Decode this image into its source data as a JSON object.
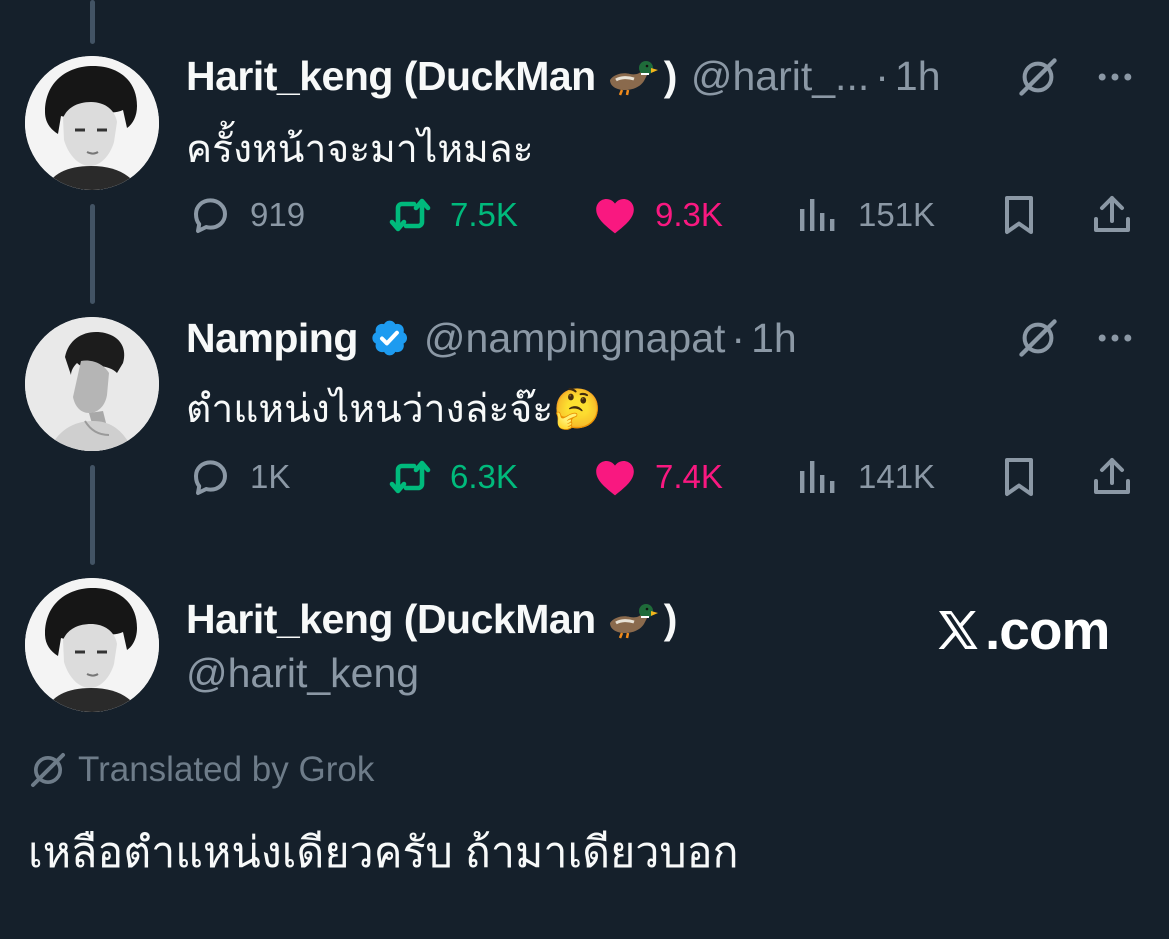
{
  "tweets": [
    {
      "display_name": "Harit_keng (DuckMan",
      "name_suffix": ")",
      "handle": "@harit_...",
      "separator": "·",
      "time": "1h",
      "text": "ครั้งหน้าจะมาไหมละ",
      "replies": "919",
      "retweets": "7.5K",
      "likes": "9.3K",
      "views": "151K"
    },
    {
      "display_name": "Namping",
      "handle": "@nampingnapat",
      "separator": "·",
      "time": "1h",
      "text": "ตำแหน่งไหนว่างล่ะจ๊ะ🤔",
      "replies": "1K",
      "retweets": "6.3K",
      "likes": "7.4K",
      "views": "141K"
    }
  ],
  "quoted": {
    "display_name": "Harit_keng (DuckMan",
    "name_suffix": ")",
    "handle": "@harit_keng",
    "watermark": ".com",
    "translated_label": "Translated by Grok",
    "translation": "เหลือตำแหน่งเดียวครับ ถ้ามาเดียวบอก"
  },
  "colors": {
    "background": "#15202b",
    "text": "#f7f9f9",
    "secondary": "#8b98a5",
    "retweet": "#00ba7c",
    "like": "#f91880",
    "verified": "#1d9bf0"
  },
  "icons": [
    "reply-icon",
    "retweet-icon",
    "heart-icon",
    "views-icon",
    "bookmark-icon",
    "share-icon",
    "grok-icon",
    "more-icon",
    "verified-icon",
    "duck-icon",
    "x-logo-icon"
  ]
}
